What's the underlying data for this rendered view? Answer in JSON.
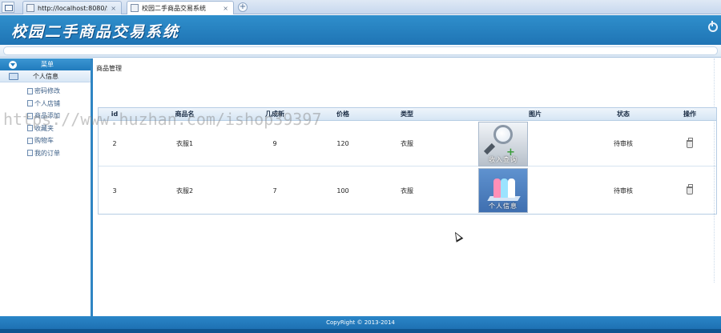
{
  "browser": {
    "tabs": [
      {
        "label": "http://localhost:8080/S..."
      },
      {
        "label": "校园二手商品交易系统"
      }
    ],
    "close_glyph": "×",
    "new_tab_glyph": "+"
  },
  "header": {
    "title": "校园二手商品交易系统",
    "logout_icon": "power-icon"
  },
  "sidebar": {
    "head_label": "菜单",
    "section_label": "个人信息",
    "items": [
      {
        "label": "密码修改"
      },
      {
        "label": "个人店铺"
      },
      {
        "label": "商品添加"
      },
      {
        "label": "收藏夹"
      },
      {
        "label": "购物车"
      },
      {
        "label": "我的订单"
      }
    ]
  },
  "main": {
    "page_title": "商品管理",
    "columns": [
      "id",
      "商品名",
      "几成新",
      "价格",
      "类型",
      "图片",
      "状态",
      "操作"
    ],
    "rows": [
      {
        "id": "2",
        "name": "衣服1",
        "condition": "9",
        "price": "120",
        "type": "衣服",
        "image_caption": "收入查询",
        "status": "待审核"
      },
      {
        "id": "3",
        "name": "衣服2",
        "condition": "7",
        "price": "100",
        "type": "衣服",
        "image_caption": "个人信息",
        "status": "待审核"
      }
    ],
    "watermark": "https://www.huzhan.com/ishop39397"
  },
  "footer": {
    "copyright": "CopyRight © 2013-2014"
  },
  "colors": {
    "header_blue": "#1f74b4",
    "sidebar_border": "#2f85c3",
    "footer_blue": "#1a6aac"
  }
}
